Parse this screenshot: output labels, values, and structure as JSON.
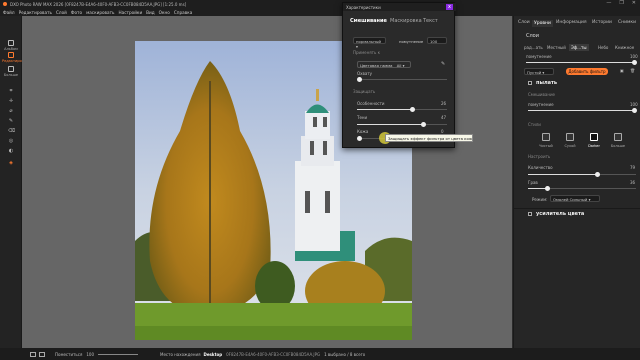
{
  "titlebar": {
    "title": "DXO Photo RAW MAX 2026 [0F8247B-E4A6-40F0-AFB3-CC0FB084D5AA.JPG] [1:25.0 ms]",
    "controls": [
      "—",
      "❐",
      "✕"
    ]
  },
  "menubar": [
    "Файл",
    "Редактировать",
    "Слой",
    "Фото",
    "маскировать",
    "Настройки",
    "Вид",
    "Окно",
    "Справка"
  ],
  "left_toolbar": {
    "modes": [
      {
        "label": "Альбом",
        "icon": "album-icon"
      },
      {
        "label": "Редактировать",
        "icon": "edit-icon",
        "active": true
      },
      {
        "label": "Больше",
        "icon": "more-icon"
      }
    ]
  },
  "dialog": {
    "title": "Характеристики",
    "close": "x",
    "tabs": [
      "Смешивание",
      "Маскировка",
      "Текст"
    ],
    "blend_mode": "нормальный",
    "opacity_label": "помутнение",
    "opacity_value": "100",
    "apply_to": "Применять к",
    "color_range_label": "Цветовая гамма",
    "color_range_value": "All",
    "opacity2_label": "Охвату",
    "protect": "Защищать",
    "sliders": [
      {
        "label": "Особенности",
        "value": "26",
        "fraction": 0.62
      },
      {
        "label": "Тени",
        "value": "47",
        "fraction": 0.74
      },
      {
        "label": "Кожа",
        "value": "0",
        "fraction": 0.3
      }
    ]
  },
  "tooltip": "Защищать эффект фильтра от цвета кожи",
  "right_panel": {
    "tabs": [
      "Слои",
      "Уровни",
      "Информация",
      "Истории",
      "Снимки"
    ],
    "section_title": "Слои",
    "subtabs": [
      "рад...ать",
      "Местный",
      "Эф...ты",
      "Небо",
      "Книжное"
    ],
    "opacity_label": "помутнение",
    "opacity_value": "100",
    "empty_select": "Пустой",
    "add_filter": "Добавить фильтр",
    "layer1_name": "пылать",
    "blend_label": "Смешивание",
    "blend_opacity_label": "помутнение",
    "blend_opacity_value": "100",
    "styles_label": "Стили",
    "styles": [
      "Чистый",
      "Сухой",
      "Darker",
      "Больше"
    ],
    "selected_style": "Darker",
    "adjust_label": "Настроить",
    "amount_label": "Количество",
    "amount_value": "79",
    "size_label": "Грав",
    "size_value": "36",
    "mode_label": "Режим:",
    "mode_value": "Омолей Сильный",
    "layer2_name": "усилитель цвета"
  },
  "bottombar": {
    "zoom_label": "Поместиться",
    "zoom_value": "100",
    "position_label": "Место нахождения",
    "location": "Desktop",
    "filename": "0F8247B-E4A6-40F0-AFB3-CC0FB084D5AA.JPG",
    "selection": "1 выбрано / 8 всего"
  },
  "colors": {
    "accent": "#ff7a2f",
    "panel_bg": "#262626",
    "canvas_bg": "#666666"
  }
}
